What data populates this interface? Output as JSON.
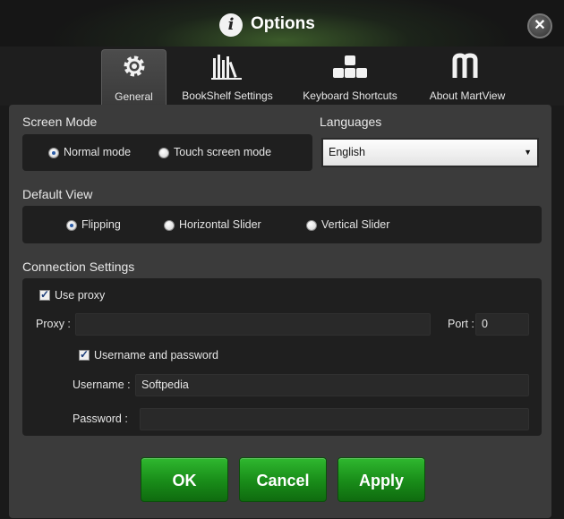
{
  "window": {
    "title": "Options",
    "close_label": "✕",
    "info_glyph": "i"
  },
  "tabs": [
    {
      "label": "General",
      "icon": "gear-icon",
      "active": true
    },
    {
      "label": "BookShelf Settings",
      "icon": "bookshelf-icon",
      "active": false
    },
    {
      "label": "Keyboard Shortcuts",
      "icon": "keyboard-icon",
      "active": false
    },
    {
      "label": "About MartView",
      "icon": "martview-logo-icon",
      "active": false
    }
  ],
  "screen_mode": {
    "title": "Screen Mode",
    "options": [
      {
        "label": "Normal mode",
        "selected": true
      },
      {
        "label": "Touch screen mode",
        "selected": false
      }
    ]
  },
  "languages": {
    "title": "Languages",
    "selected": "English"
  },
  "default_view": {
    "title": "Default View",
    "options": [
      {
        "label": "Flipping",
        "selected": true
      },
      {
        "label": "Horizontal Slider",
        "selected": false
      },
      {
        "label": "Vertical Slider",
        "selected": false
      }
    ]
  },
  "connection": {
    "title": "Connection Settings",
    "use_proxy_label": "Use proxy",
    "use_proxy_checked": true,
    "proxy_label": "Proxy :",
    "proxy_value": "",
    "port_label": "Port :",
    "port_value": "0",
    "auth_label": "Username and password",
    "auth_checked": true,
    "username_label": "Username :",
    "username_value": "Softpedia",
    "password_label": "Password :",
    "password_value": ""
  },
  "buttons": {
    "ok": "OK",
    "cancel": "Cancel",
    "apply": "Apply"
  },
  "colors": {
    "button_green": "#1a8f1a",
    "panel_bg": "#3b3b3b",
    "box_bg": "#1f1f1f"
  }
}
